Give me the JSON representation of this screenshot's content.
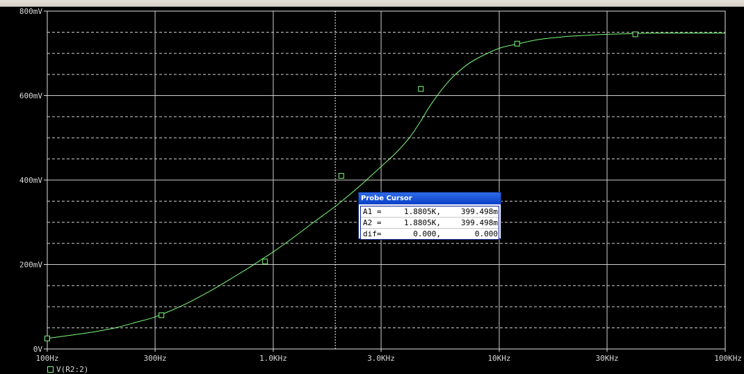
{
  "chart_data": {
    "type": "line",
    "x_scale": "log",
    "xlim": [
      100,
      100000
    ],
    "ylim": [
      0,
      800
    ],
    "y_unit": "mV",
    "x_ticks": [
      {
        "value": 100,
        "label": "100Hz"
      },
      {
        "value": 300,
        "label": "300Hz"
      },
      {
        "value": 1000,
        "label": "1.0KHz"
      },
      {
        "value": 3000,
        "label": "3.0KHz"
      },
      {
        "value": 10000,
        "label": "10KHz"
      },
      {
        "value": 30000,
        "label": "30KHz"
      },
      {
        "value": 100000,
        "label": "100KHz"
      }
    ],
    "y_ticks": [
      {
        "value": 0,
        "label": "0V"
      },
      {
        "value": 200,
        "label": "200mV"
      },
      {
        "value": 400,
        "label": "400mV"
      },
      {
        "value": 600,
        "label": "600mV"
      },
      {
        "value": 800,
        "label": "800mV"
      }
    ],
    "series": [
      {
        "name": "V(R2:2)",
        "color": "#7cfc7c",
        "x": [
          100,
          150,
          200,
          250,
          300,
          400,
          500,
          600,
          700,
          800,
          900,
          1000,
          1200,
          1500,
          1800,
          2000,
          2500,
          3000,
          3500,
          4000,
          4500,
          5000,
          6000,
          7000,
          8000,
          10000,
          12000,
          15000,
          20000,
          25000,
          30000,
          40000,
          50000,
          70000,
          100000
        ],
        "y": [
          25,
          38,
          50,
          64,
          76,
          104,
          131,
          155,
          177,
          196,
          214,
          230,
          260,
          299,
          330,
          349,
          393,
          432,
          465,
          500,
          540,
          580,
          635,
          668,
          688,
          712,
          722,
          733,
          740,
          743,
          745,
          747,
          748,
          748,
          748
        ]
      }
    ],
    "markers": [
      {
        "x": 100,
        "y": 25
      },
      {
        "x": 320,
        "y": 80
      },
      {
        "x": 920,
        "y": 207
      },
      {
        "x": 2000,
        "y": 410
      },
      {
        "x": 4500,
        "y": 616
      },
      {
        "x": 12000,
        "y": 723
      },
      {
        "x": 40000,
        "y": 745
      }
    ],
    "cursor_x": 1880.5,
    "grid": true
  },
  "probe_cursor": {
    "title": "Probe Cursor",
    "rows": [
      [
        "A1 =",
        "1.8805K,",
        "399.498m"
      ],
      [
        "A2 =",
        "1.8805K,",
        "399.498m"
      ],
      [
        "dif=",
        "0.000,",
        "0.000"
      ]
    ]
  },
  "legend": {
    "label": "V(R2:2)"
  },
  "colors": {
    "trace": "#7cfc7c",
    "grid": "#cfcfcf",
    "background": "#000000",
    "text": "#d8d8d8"
  }
}
